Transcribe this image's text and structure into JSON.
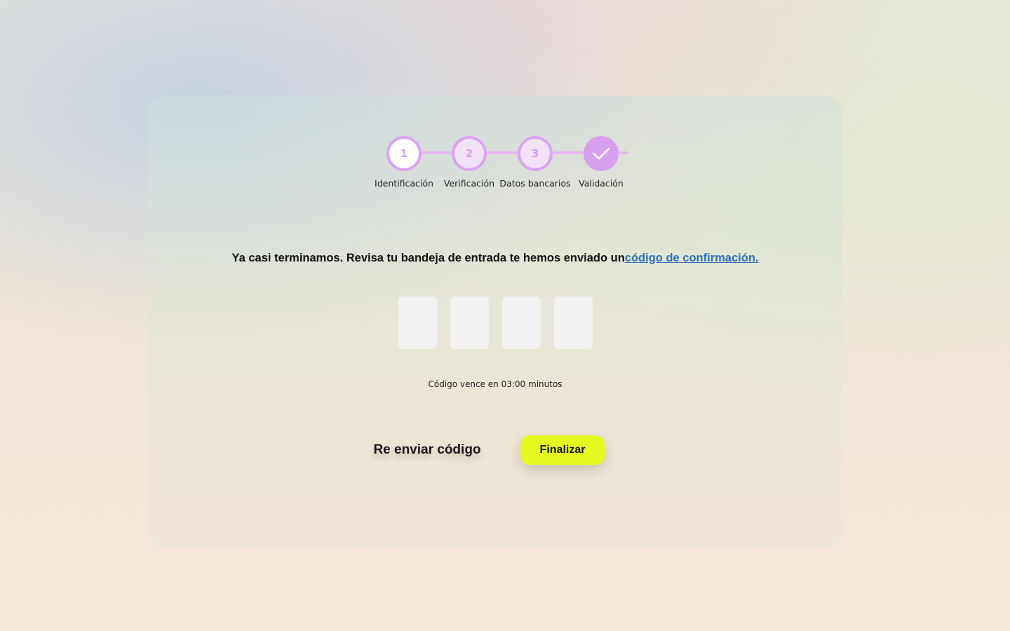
{
  "stepper": {
    "steps": [
      {
        "number": "1",
        "label": "Identificación",
        "state": "active"
      },
      {
        "number": "2",
        "label": "Verificación",
        "state": "pending"
      },
      {
        "number": "3",
        "label": "Datos bancarios",
        "state": "pending"
      },
      {
        "number": "",
        "label": "Validación",
        "state": "done",
        "icon": "check-icon"
      }
    ]
  },
  "message": {
    "text": "Ya casi terminamos. Revisa tu bandeja de entrada te hemos enviado un",
    "link_text": "código de confirmación."
  },
  "code_inputs": [
    "",
    "",
    "",
    ""
  ],
  "expire_text": "Código vence en 03:00 minutos",
  "actions": {
    "resend_label": "Re enviar código",
    "finish_label": "Finalizar"
  },
  "colors": {
    "step_accent": "#dca3f1",
    "link": "#2c72b8",
    "primary_button": "#e5fa21"
  }
}
